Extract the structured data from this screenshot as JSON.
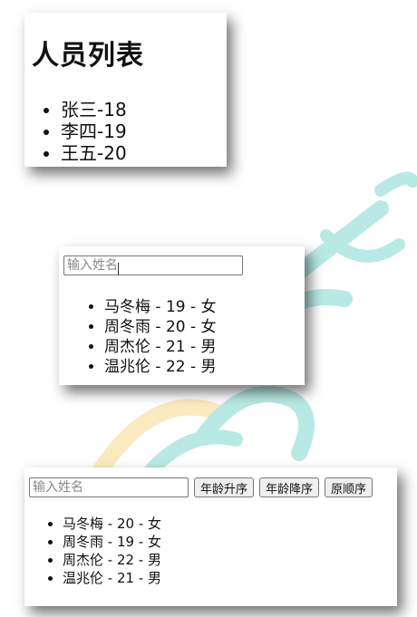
{
  "card1": {
    "title": "人员列表",
    "items": [
      "张三-18",
      "李四-19",
      "王五-20"
    ]
  },
  "card2": {
    "search_placeholder": "输入姓名",
    "items": [
      "马冬梅 - 19 - 女",
      "周冬雨 - 20 - 女",
      "周杰伦 - 21 - 男",
      "温兆伦 - 22 - 男"
    ]
  },
  "card3": {
    "search_placeholder": "输入姓名",
    "buttons": {
      "age_asc": "年龄升序",
      "age_desc": "年龄降序",
      "original": "原顺序"
    },
    "items": [
      "马冬梅 - 20 - 女",
      "周冬雨 - 19 - 女",
      "周杰伦 - 22 - 男",
      "温兆伦 - 21 - 男"
    ]
  },
  "colors": {
    "watermark_teal": "#38c2b4",
    "watermark_yellow": "#f6c24a"
  }
}
